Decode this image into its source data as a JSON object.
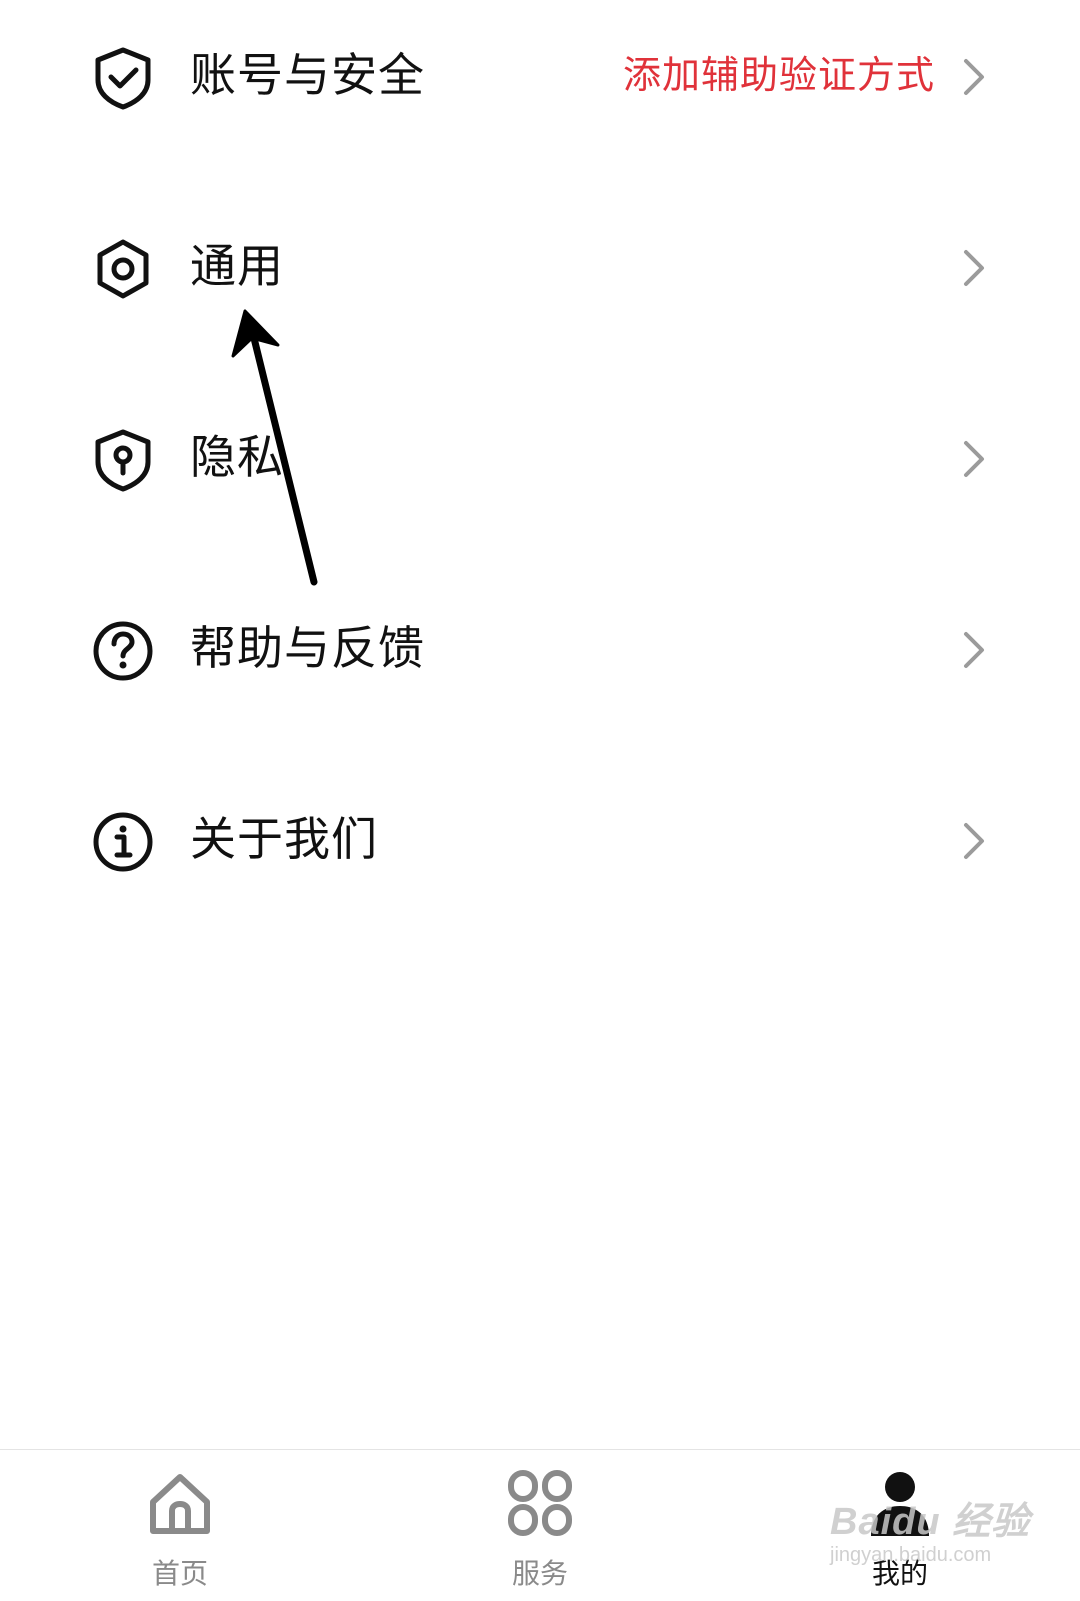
{
  "menu": {
    "items": [
      {
        "label": "账号与安全",
        "hint": "添加辅助验证方式",
        "icon": "shield-check-icon"
      },
      {
        "label": "通用",
        "hint": "",
        "icon": "hex-settings-icon"
      },
      {
        "label": "隐私",
        "hint": "",
        "icon": "shield-keyhole-icon"
      },
      {
        "label": "帮助与反馈",
        "hint": "",
        "icon": "question-circle-icon"
      },
      {
        "label": "关于我们",
        "hint": "",
        "icon": "info-circle-icon"
      }
    ],
    "hint_color": "#e0323a",
    "chevron_icon": "chevron-right-icon"
  },
  "tabbar": {
    "tabs": [
      {
        "label": "首页",
        "icon": "home-icon",
        "active": false
      },
      {
        "label": "服务",
        "icon": "grid-services-icon",
        "active": false
      },
      {
        "label": "我的",
        "icon": "user-icon",
        "active": true
      }
    ],
    "active_color": "#111111",
    "inactive_color": "#8a8a8a"
  },
  "watermark": {
    "text": "Baidu 经验",
    "sub": "jingyan.baidu.com"
  }
}
